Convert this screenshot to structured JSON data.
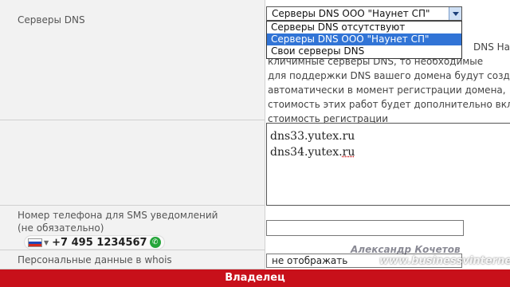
{
  "dns_row": {
    "label": "Серверы DNS",
    "selected_value": "Серверы DNS ООО \"Наунет СП\"",
    "options": [
      "Серверы DNS отсутствуют",
      "Серверы DNS ООО \"Наунет СП\"",
      "Свои серверы DNS"
    ]
  },
  "note": {
    "line1": "DNS Наунет",
    "line2": "кли​чи​мные серверы DNS, то необходимые",
    "line3": "для поддержки DNS вашего домена будут создан",
    "line4": "автоматически в момент регистрации домена,",
    "line5": "стоимость этих работ будет дополнительно вкл",
    "line6": "стоимость регистрации"
  },
  "servers": {
    "line1": "dns33.yutex.ru",
    "line2_prefix": "dns34.yutex.",
    "line2_suffix": "ru"
  },
  "phone_row": {
    "label_line1": "Номер телефона для SMS уведомлений",
    "label_line2": "(не обязательно)",
    "phone_number": "+7 495 1234567",
    "input_value": ""
  },
  "whois_row": {
    "label": "Персональные данные в whois",
    "selected_value": "не отображать"
  },
  "owner_bar": {
    "title": "Владелец"
  },
  "watermark": {
    "author": "Александр Кочетов",
    "site": "www.businessvinternet.ru"
  },
  "colors": {
    "accent_red": "#c8101a",
    "selection_blue": "#3174d6"
  }
}
